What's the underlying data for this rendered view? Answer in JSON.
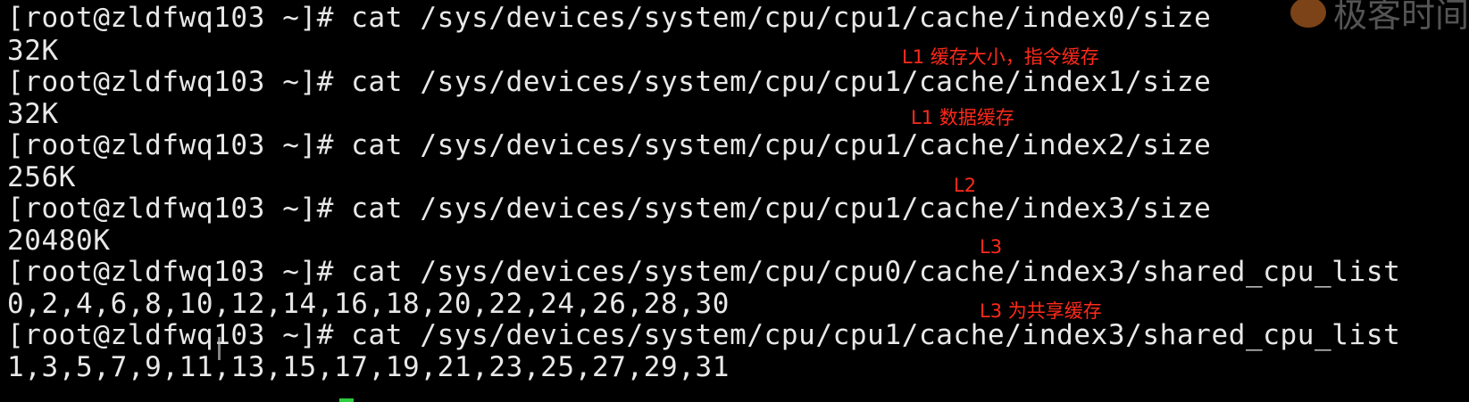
{
  "terminal": {
    "lines": [
      "[root@zldfwq103 ~]# cat /sys/devices/system/cpu/cpu1/cache/index0/size",
      "32K",
      "[root@zldfwq103 ~]# cat /sys/devices/system/cpu/cpu1/cache/index1/size",
      "32K",
      "[root@zldfwq103 ~]# cat /sys/devices/system/cpu/cpu1/cache/index2/size",
      "256K",
      "[root@zldfwq103 ~]# cat /sys/devices/system/cpu/cpu1/cache/index3/size",
      "20480K",
      "[root@zldfwq103 ~]# cat /sys/devices/system/cpu/cpu0/cache/index3/shared_cpu_list",
      "0,2,4,6,8,10,12,14,16,18,20,22,24,26,28,30",
      "[root@zldfwq103 ~]# cat /sys/devices/system/cpu/cpu1/cache/index3/shared_cpu_list",
      "1,3,5,7,9,11,13,15,17,19,21,23,25,27,29,31"
    ]
  },
  "annotations": [
    "L1 缓存大小，指令缓存",
    "L1 数据缓存",
    "L2",
    "L3",
    "L3 为共享缓存"
  ],
  "watermark": {
    "text": "极客时间"
  },
  "colors": {
    "background": "#000000",
    "terminal_text": "#e8e8e8",
    "annotation": "#ff2a1a"
  }
}
